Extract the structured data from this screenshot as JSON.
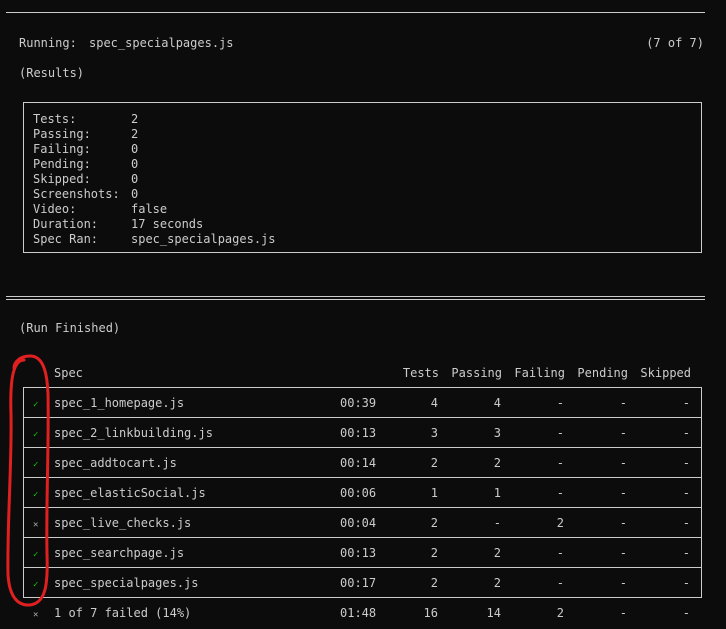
{
  "run": {
    "running_label": "Running:",
    "spec_name": "spec_specialpages.js",
    "progress": "(7 of 7)",
    "results_heading": "(Results)"
  },
  "results": [
    {
      "label": "Tests:",
      "value": "2"
    },
    {
      "label": "Passing:",
      "value": "2"
    },
    {
      "label": "Failing:",
      "value": "0"
    },
    {
      "label": "Pending:",
      "value": "0"
    },
    {
      "label": "Skipped:",
      "value": "0"
    },
    {
      "label": "Screenshots:",
      "value": "0"
    },
    {
      "label": "Video:",
      "value": "false"
    },
    {
      "label": "Duration:",
      "value": "17 seconds"
    },
    {
      "label": "Spec Ran:",
      "value": "spec_specialpages.js"
    }
  ],
  "finished_heading": "(Run Finished)",
  "table": {
    "headers": {
      "spec": "Spec",
      "tests": "Tests",
      "passing": "Passing",
      "failing": "Failing",
      "pending": "Pending",
      "skipped": "Skipped"
    },
    "rows": [
      {
        "status": "pass",
        "icon": "✓",
        "spec": "spec_1_homepage.js",
        "time": "00:39",
        "tests": "4",
        "passing": "4",
        "failing": "-",
        "pending": "-",
        "skipped": "-"
      },
      {
        "status": "pass",
        "icon": "✓",
        "spec": "spec_2_linkbuilding.js",
        "time": "00:13",
        "tests": "3",
        "passing": "3",
        "failing": "-",
        "pending": "-",
        "skipped": "-"
      },
      {
        "status": "pass",
        "icon": "✓",
        "spec": "spec_addtocart.js",
        "time": "00:14",
        "tests": "2",
        "passing": "2",
        "failing": "-",
        "pending": "-",
        "skipped": "-"
      },
      {
        "status": "pass",
        "icon": "✓",
        "spec": "spec_elasticSocial.js",
        "time": "00:06",
        "tests": "1",
        "passing": "1",
        "failing": "-",
        "pending": "-",
        "skipped": "-"
      },
      {
        "status": "fail",
        "icon": "✕",
        "spec": "spec_live_checks.js",
        "time": "00:04",
        "tests": "2",
        "passing": "-",
        "failing": "2",
        "pending": "-",
        "skipped": "-"
      },
      {
        "status": "pass",
        "icon": "✓",
        "spec": "spec_searchpage.js",
        "time": "00:13",
        "tests": "2",
        "passing": "2",
        "failing": "-",
        "pending": "-",
        "skipped": "-"
      },
      {
        "status": "pass",
        "icon": "✓",
        "spec": "spec_specialpages.js",
        "time": "00:17",
        "tests": "2",
        "passing": "2",
        "failing": "-",
        "pending": "-",
        "skipped": "-"
      }
    ],
    "summary": {
      "icon": "✕",
      "spec": "1 of 7 failed (14%)",
      "time": "01:48",
      "tests": "16",
      "passing": "14",
      "failing": "2",
      "pending": "-",
      "skipped": "-"
    }
  },
  "colors": {
    "background": "#0c0c0c",
    "text": "#cccccc",
    "pass": "#16c60c",
    "annotation": "#e02020"
  }
}
